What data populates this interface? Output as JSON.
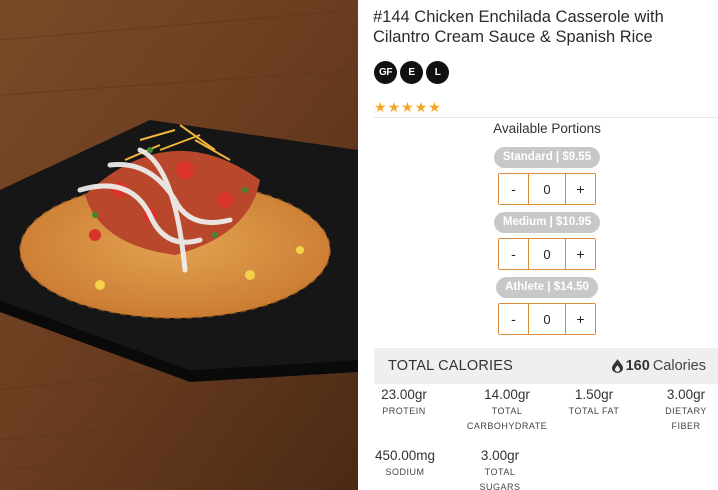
{
  "product": {
    "title": "#144 Chicken Enchilada Casserole with Cilantro Cream Sauce & Spanish Rice",
    "tags": [
      "GF",
      "E",
      "L"
    ],
    "rating_stars": 5
  },
  "portions": {
    "heading": "Available Portions",
    "items": [
      {
        "label": "Standard | $9.55",
        "quantity": "0"
      },
      {
        "label": "Medium | $10.95",
        "quantity": "0"
      },
      {
        "label": "Athlete | $14.50",
        "quantity": "0"
      }
    ],
    "minus_symbol": "-",
    "plus_symbol": "+"
  },
  "calories": {
    "label": "TOTAL CALORIES",
    "value": "160",
    "unit": "Calories"
  },
  "nutrition": [
    {
      "value": "23.00gr",
      "label": "PROTEIN"
    },
    {
      "value": "14.00gr",
      "label": "TOTAL CARBOHYDRATE"
    },
    {
      "value": "1.50gr",
      "label": "TOTAL FAT"
    },
    {
      "value": "3.00gr",
      "label": "DIETARY FIBER"
    },
    {
      "value": "450.00mg",
      "label": "SODIUM"
    },
    {
      "value": "3.00gr",
      "label": "TOTAL SUGARS"
    }
  ],
  "colors": {
    "star": "#f5a623",
    "stepper_border": "#d98a3a",
    "pill_bg": "#c8c8c8",
    "calorie_bar_bg": "#efefef"
  }
}
